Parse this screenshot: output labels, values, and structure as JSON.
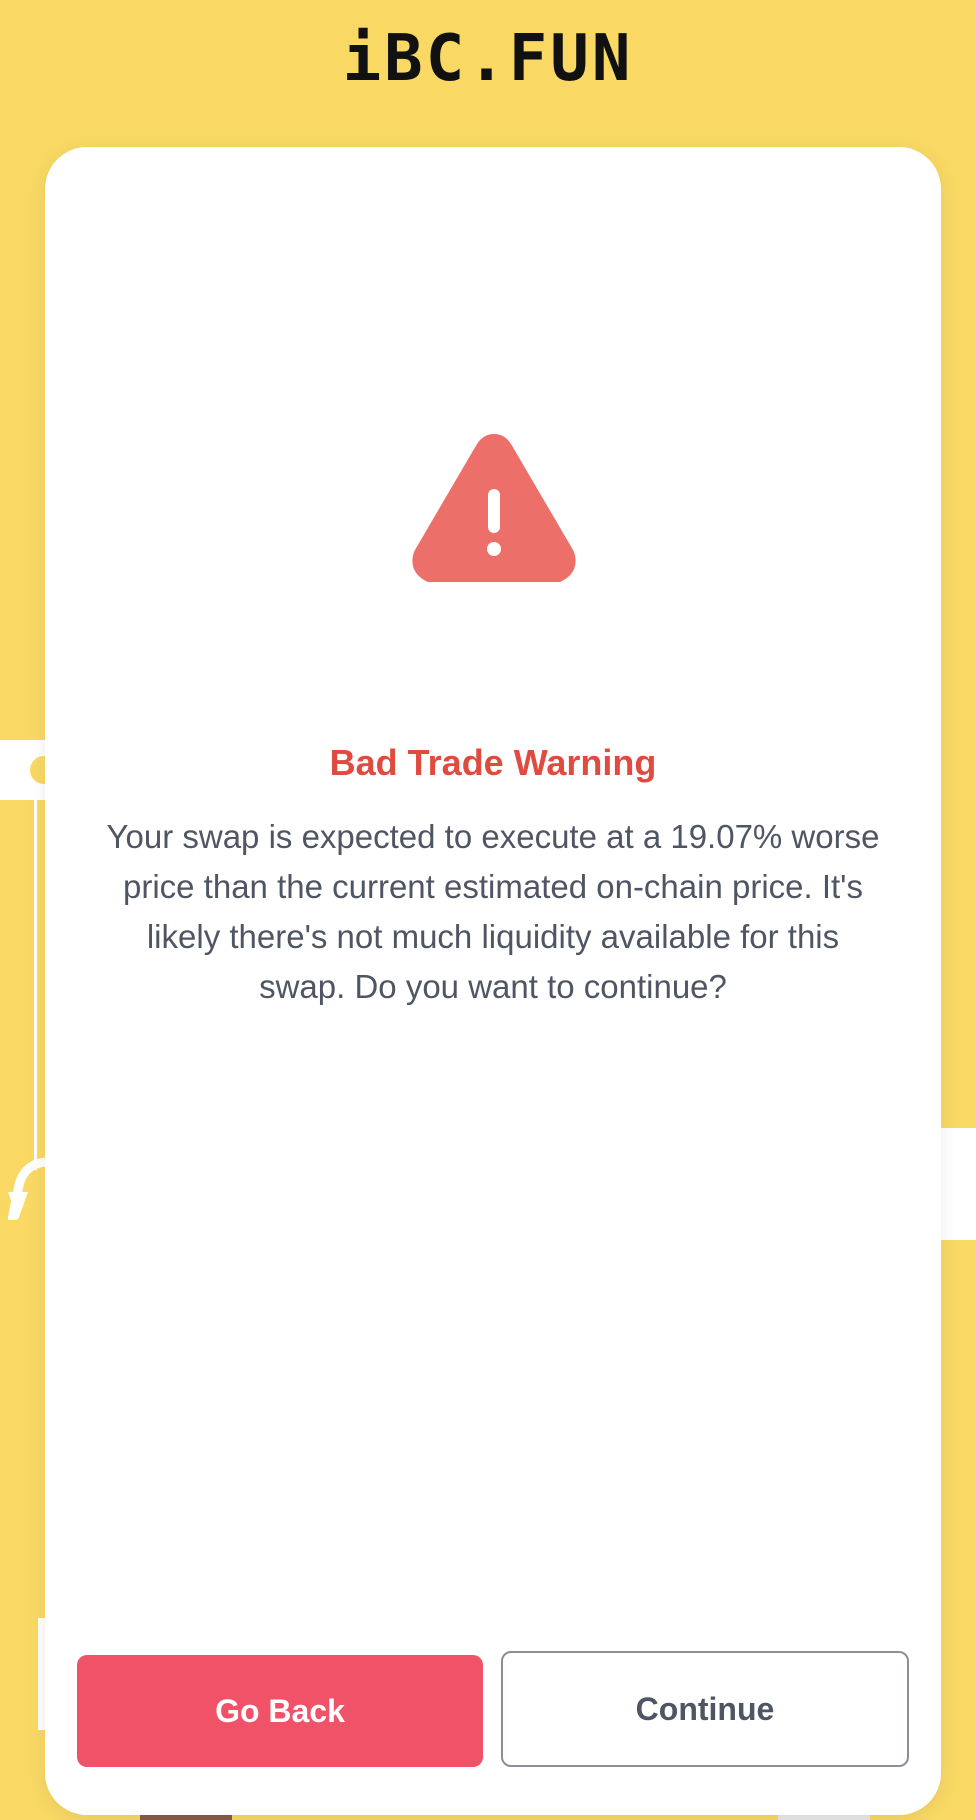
{
  "header": {
    "logo_text": "iBC.FUN"
  },
  "modal": {
    "icon": "warning-triangle-icon",
    "title": "Bad Trade Warning",
    "message": "Your swap is expected to execute at a 19.07% worse price than the current estimated on-chain price. It's likely there's not much liquidity available for this swap. Do you want to continue?",
    "buttons": {
      "back_label": "Go Back",
      "continue_label": "Continue"
    }
  },
  "colors": {
    "background": "#f9d964",
    "warning": "#ec6f69",
    "title": "#e04a3f",
    "primary_button": "#f05268",
    "text": "#4f5563"
  }
}
